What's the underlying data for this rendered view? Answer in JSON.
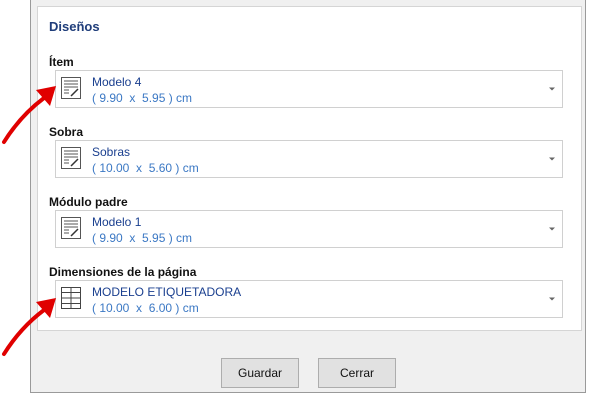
{
  "panel": {
    "title": "Diseños",
    "fields": [
      {
        "label": "Ítem",
        "name": "Modelo 4",
        "dims": "( 9.90  x  5.95 ) cm",
        "icon": "label-design-icon"
      },
      {
        "label": "Sobra",
        "name": "Sobras",
        "dims": "( 10.00  x  5.60 ) cm",
        "icon": "label-design-icon"
      },
      {
        "label": "Módulo padre",
        "name": "Modelo 1",
        "dims": "( 9.90  x  5.95 ) cm",
        "icon": "label-design-icon"
      },
      {
        "label": "Dimensiones de la página",
        "name": "MODELO ETIQUETADORA",
        "dims": "( 10.00  x  6.00 ) cm",
        "icon": "label-grid-icon"
      }
    ]
  },
  "buttons": {
    "save": "Guardar",
    "close": "Cerrar"
  },
  "colors": {
    "accent_name": "#1a3f8f",
    "accent_dims": "#3b78c4",
    "annotation_arrow": "#e00000"
  }
}
